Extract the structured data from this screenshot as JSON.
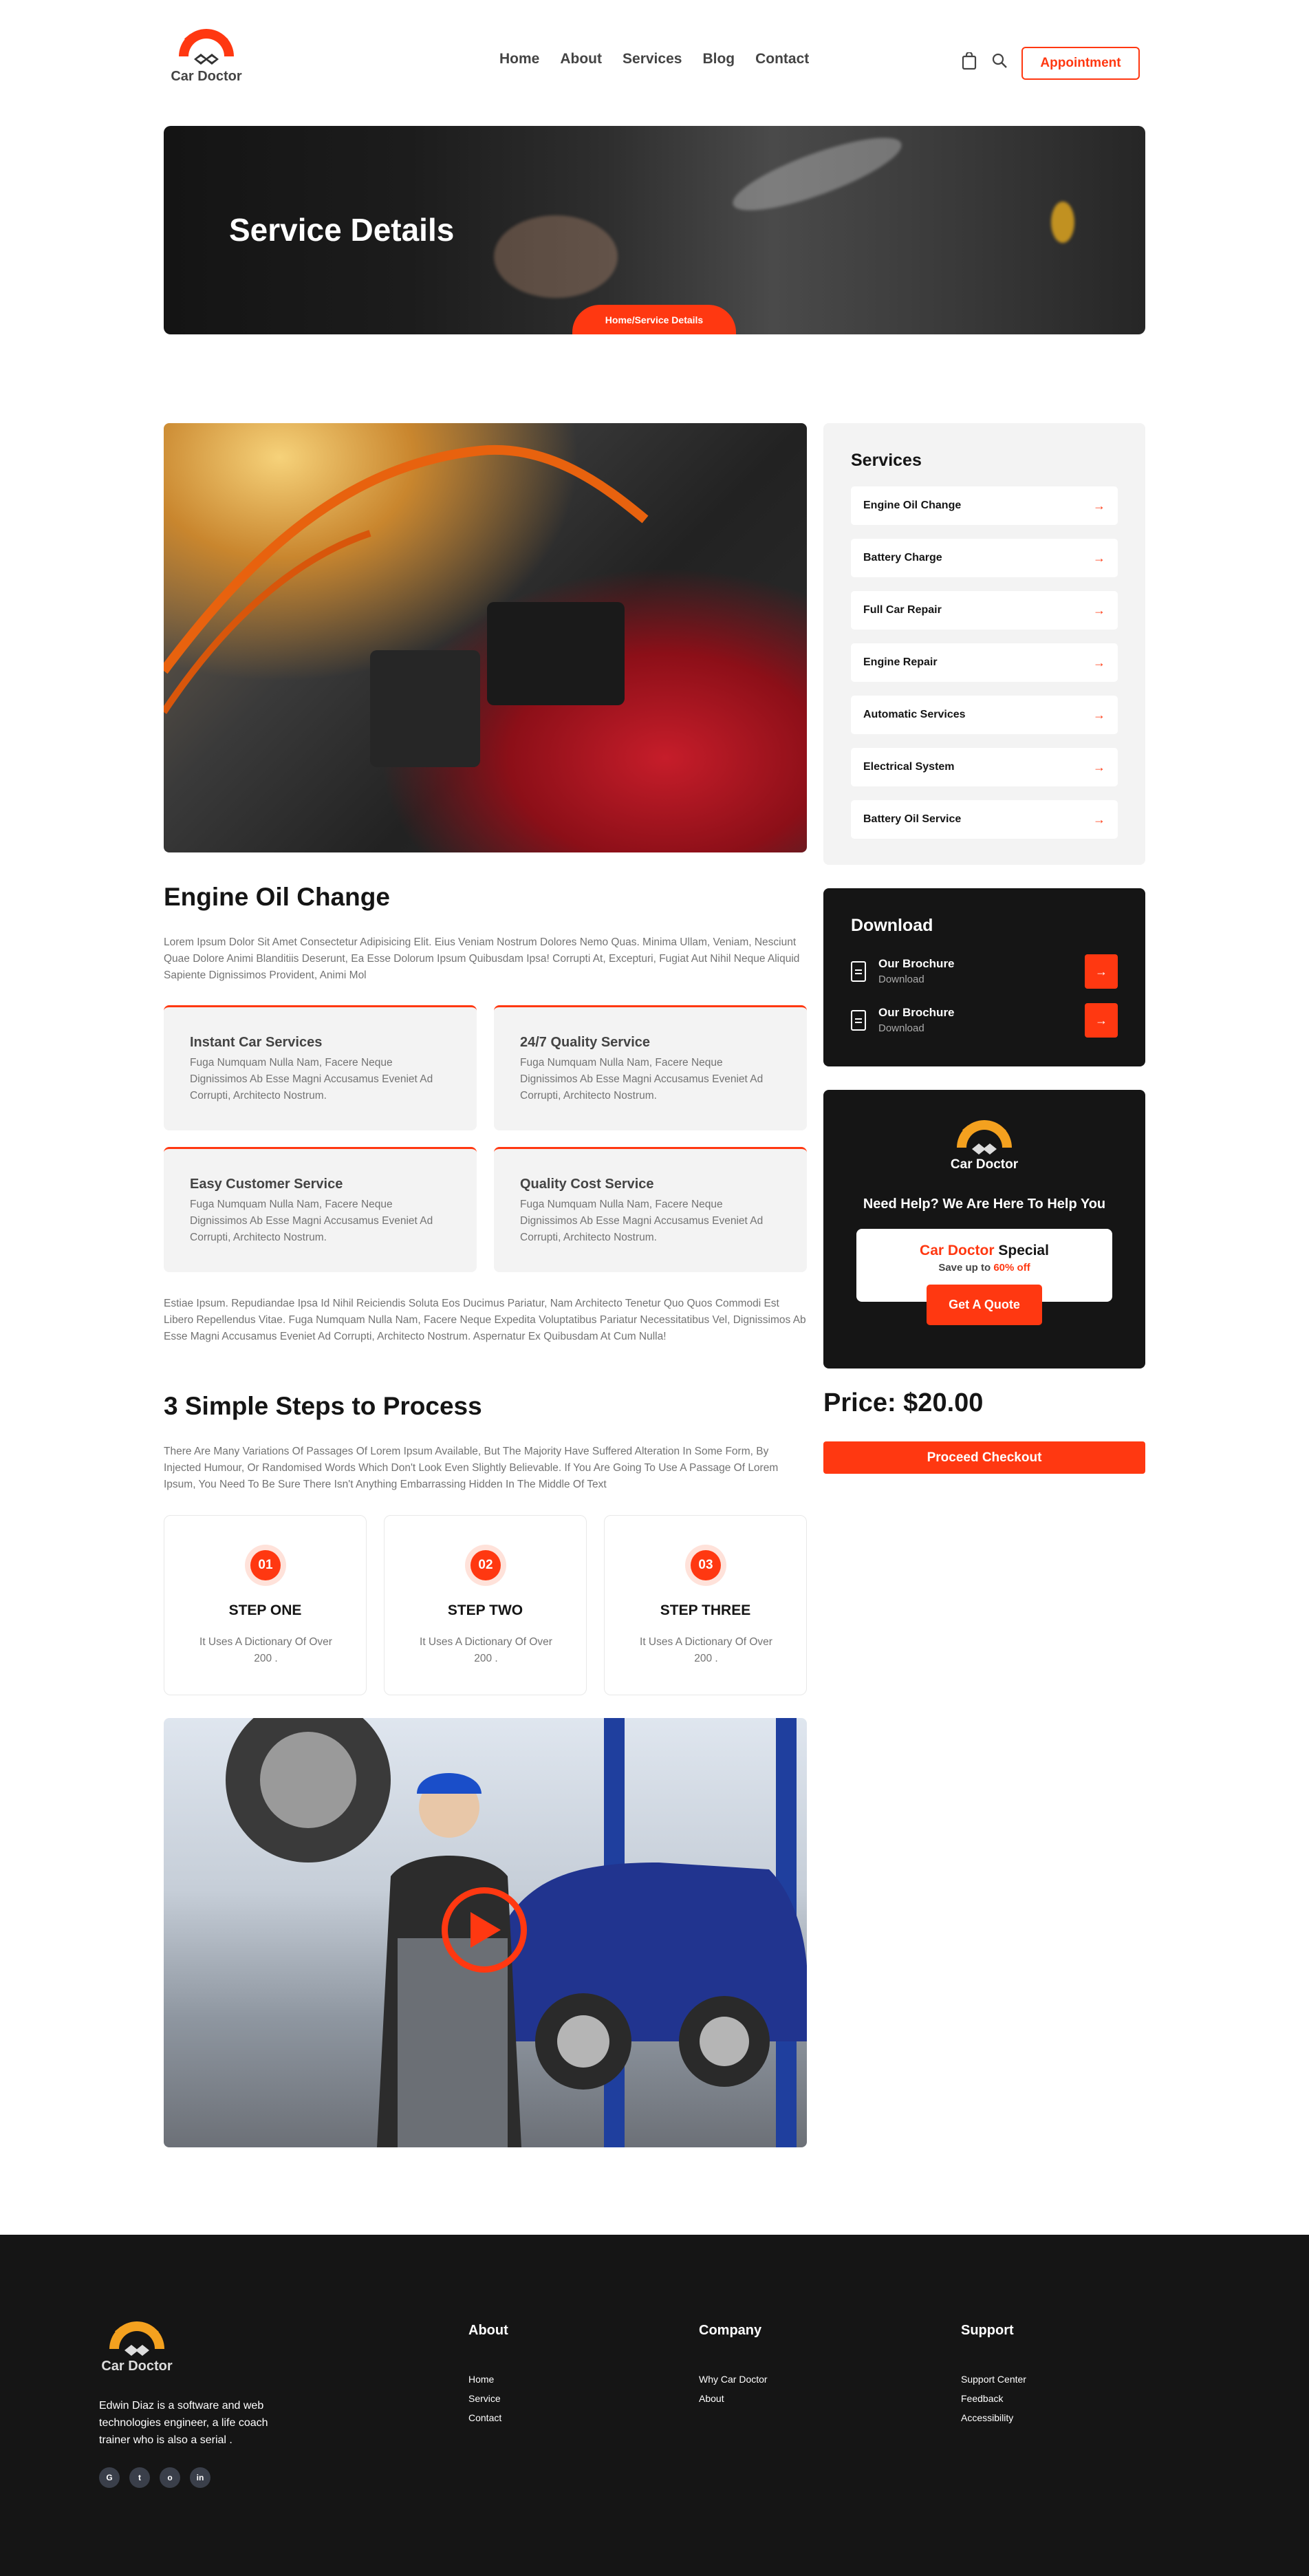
{
  "brand": {
    "name": "Car Doctor",
    "accent": "#FF3811",
    "dark": "#151515",
    "logo_orange": "#FF7A00"
  },
  "nav": {
    "links": [
      "Home",
      "About",
      "Services",
      "Blog",
      "Contact"
    ],
    "appointment": "Appointment",
    "icons": [
      "bag-icon",
      "search-icon"
    ]
  },
  "hero": {
    "title": "Service Details",
    "breadcrumb": "Home/Service Details"
  },
  "sidebar": {
    "services_title": "Services",
    "services": [
      "Engine Oil Change",
      "Battery Charge",
      "Full Car Repair",
      "Engine Repair",
      "Automatic Services",
      "Electrical System",
      "Battery Oil Service"
    ],
    "download_title": "Download",
    "downloads": [
      {
        "title": "Our Brochure",
        "sub": "Download"
      },
      {
        "title": "Our Brochure",
        "sub": "Download"
      }
    ],
    "help_title": "Need Help? We Are Here To Help You",
    "special_brand": "Car Doctor",
    "special_word": "Special",
    "special_save": "Save up to",
    "special_off": "60% off",
    "quote_button": "Get A Quote",
    "price": "Price: $20.00",
    "checkout": "Proceed Checkout"
  },
  "main": {
    "title": "Engine Oil Change",
    "intro": "Lorem Ipsum Dolor Sit Amet Consectetur Adipisicing Elit. Eius Veniam Nostrum Dolores Nemo Quas. Minima Ullam, Veniam, Nesciunt Quae Dolore Animi Blanditiis Deserunt, Ea Esse Dolorum Ipsum Quibusdam Ipsa! Corrupti At, Excepturi, Fugiat Aut Nihil Neque Aliquid Sapiente Dignissimos Provident, Animi Mol",
    "features": [
      {
        "title": "Instant Car Services",
        "desc": "Fuga Numquam Nulla Nam, Facere Neque Dignissimos Ab Esse Magni Accusamus Eveniet Ad Corrupti, Architecto Nostrum."
      },
      {
        "title": "24/7 Quality Service",
        "desc": "Fuga Numquam Nulla Nam, Facere Neque Dignissimos Ab Esse Magni Accusamus Eveniet Ad Corrupti, Architecto Nostrum."
      },
      {
        "title": "Easy Customer Service",
        "desc": "Fuga Numquam Nulla Nam, Facere Neque Dignissimos Ab Esse Magni Accusamus Eveniet Ad Corrupti, Architecto Nostrum."
      },
      {
        "title": "Quality Cost Service",
        "desc": "Fuga Numquam Nulla Nam, Facere Neque Dignissimos Ab Esse Magni Accusamus Eveniet Ad Corrupti, Architecto Nostrum."
      }
    ],
    "outro": "Estiae Ipsum. Repudiandae Ipsa Id Nihil Reiciendis Soluta Eos Ducimus Pariatur, Nam Architecto Tenetur Quo Quos Commodi Est Libero Repellendus Vitae. Fuga Numquam Nulla Nam, Facere Neque Expedita Voluptatibus Pariatur Necessitatibus Vel, Dignissimos Ab Esse Magni Accusamus Eveniet Ad Corrupti, Architecto Nostrum. Aspernatur Ex Quibusdam At Cum Nulla!",
    "steps_title": "3 Simple Steps to Process",
    "steps_intro": "There Are Many Variations Of Passages Of Lorem Ipsum Available, But The Majority Have Suffered Alteration In Some Form, By Injected Humour, Or Randomised Words Which Don't Look Even Slightly Believable. If You Are Going To Use A Passage Of Lorem Ipsum, You Need To Be Sure There Isn't Anything Embarrassing Hidden In The Middle Of Text",
    "steps": [
      {
        "num": "01",
        "title": "STEP ONE",
        "desc": "It Uses A Dictionary Of Over 200 ."
      },
      {
        "num": "02",
        "title": "STEP TWO",
        "desc": "It Uses A Dictionary Of Over 200 ."
      },
      {
        "num": "03",
        "title": "STEP THREE",
        "desc": "It Uses A Dictionary Of Over 200 ."
      }
    ]
  },
  "footer": {
    "description": "Edwin Diaz is a software and web technologies engineer, a life coach trainer who is also a serial .",
    "social": [
      "G",
      "t",
      "o",
      "in"
    ],
    "columns": [
      {
        "title": "About",
        "links": [
          "Home",
          "Service",
          "Contact"
        ]
      },
      {
        "title": "Company",
        "links": [
          "Why Car Doctor",
          "About"
        ]
      },
      {
        "title": "Support",
        "links": [
          "Support Center",
          "Feedback",
          "Accessibility"
        ]
      }
    ]
  }
}
